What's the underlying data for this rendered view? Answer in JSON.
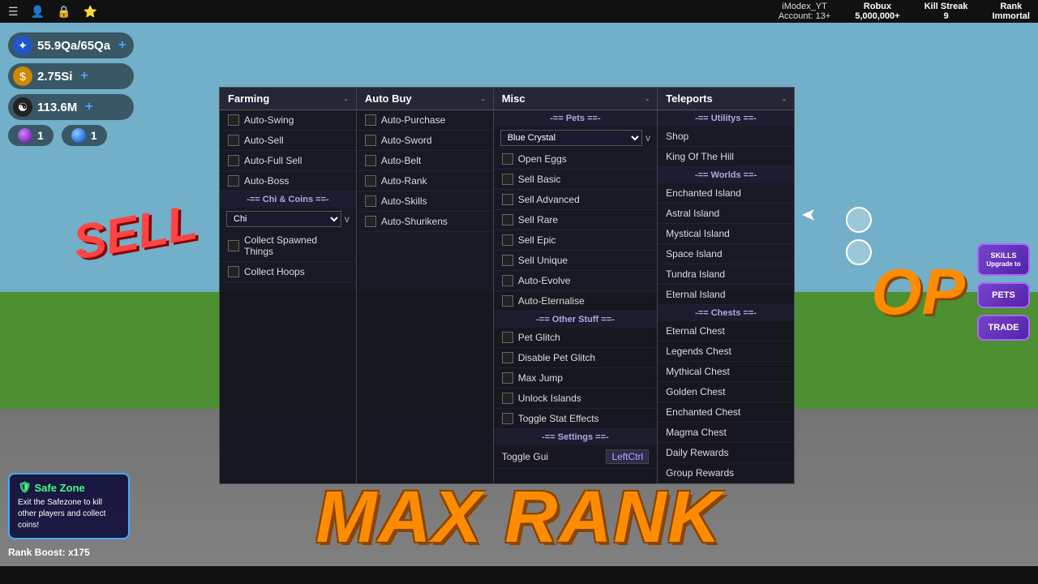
{
  "topBar": {
    "icons": [
      "☰",
      "👤",
      "🔒",
      "⭐"
    ],
    "user": {
      "name": "iModex_YT",
      "account": "Account: 13+"
    },
    "stats": [
      {
        "label": "Robux",
        "value": "5,000,000+"
      },
      {
        "label": "Kill Streak",
        "value": "9"
      },
      {
        "label": "Rank",
        "value": "Immortal"
      }
    ]
  },
  "hud": {
    "energy": {
      "value": "55.9Qa/65Qa",
      "icon": "✦"
    },
    "coins": {
      "value": "2.75Si",
      "icon": "$"
    },
    "chi": {
      "value": "113.6M",
      "icon": "☯"
    },
    "gems": [
      {
        "value": "1",
        "type": "purple"
      },
      {
        "value": "1",
        "type": "blue"
      }
    ]
  },
  "safeZone": {
    "title": "Safe Zone",
    "description": "Exit the Safezone to kill other players and collect coins!",
    "rankBoost": "Rank Boost: x175"
  },
  "rightButtons": [
    {
      "label": "SKILLS\nUpgrade to"
    },
    {
      "label": "PETS"
    },
    {
      "label": "TRADE"
    }
  ],
  "gameText": {
    "sell": "SELL",
    "maxRank": "MAX RANK",
    "op": "OP"
  },
  "menu": {
    "farming": {
      "header": "Farming",
      "dash": "-",
      "items": [
        {
          "label": "Auto-Swing",
          "hasCheckbox": true
        },
        {
          "label": "Auto-Sell",
          "hasCheckbox": true
        },
        {
          "label": "Auto-Full Sell",
          "hasCheckbox": true
        },
        {
          "label": "Auto-Boss",
          "hasCheckbox": true
        }
      ],
      "sections": [
        {
          "label": "-== Chi & Coins ==-",
          "items": [
            {
              "label": "Chi",
              "isSelect": true,
              "value": "Chi",
              "hasDropdown": true
            }
          ]
        },
        {
          "items": [
            {
              "label": "Collect Spawned Things",
              "hasCheckbox": true
            },
            {
              "label": "Collect Hoops",
              "hasCheckbox": true
            }
          ]
        }
      ]
    },
    "autoBuy": {
      "header": "Auto Buy",
      "dash": "-",
      "items": [
        {
          "label": "Auto-Purchase",
          "hasCheckbox": true
        },
        {
          "label": "Auto-Sword",
          "hasCheckbox": true
        },
        {
          "label": "Auto-Belt",
          "hasCheckbox": true
        },
        {
          "label": "Auto-Rank",
          "hasCheckbox": true
        },
        {
          "label": "Auto-Skills",
          "hasCheckbox": true
        },
        {
          "label": "Auto-Shurikens",
          "hasCheckbox": true
        }
      ]
    },
    "misc": {
      "header": "Misc",
      "dash": "-",
      "sections": [
        {
          "label": "-== Pets ==-",
          "items": [
            {
              "label": "Blue Crystal",
              "isSelect": true,
              "hasDropdown": true
            }
          ],
          "extraItems": [
            {
              "label": "Open Eggs",
              "hasCheckbox": true
            },
            {
              "label": "Sell Basic",
              "hasCheckbox": true
            },
            {
              "label": "Sell Advanced",
              "hasCheckbox": true
            },
            {
              "label": "Sell Rare",
              "hasCheckbox": true
            },
            {
              "label": "Sell Epic",
              "hasCheckbox": true
            },
            {
              "label": "Sell Unique",
              "hasCheckbox": true
            },
            {
              "label": "Auto-Evolve",
              "hasCheckbox": true
            },
            {
              "label": "Auto-Eternalise",
              "hasCheckbox": true
            }
          ]
        },
        {
          "label": "-== Other Stuff ==-",
          "items": [
            {
              "label": "Pet Glitch",
              "hasCheckbox": true
            },
            {
              "label": "Disable Pet Glitch",
              "hasCheckbox": true
            },
            {
              "label": "Max Jump",
              "hasCheckbox": true
            },
            {
              "label": "Unlock Islands",
              "hasCheckbox": true
            },
            {
              "label": "Toggle Stat Effects",
              "hasCheckbox": true
            }
          ]
        },
        {
          "label": "-== Settings ==-",
          "items": [
            {
              "label": "Toggle Gui",
              "isToggle": true,
              "toggleValue": "LeftCtrl"
            }
          ]
        }
      ]
    },
    "teleports": {
      "header": "Teleports",
      "dash": "-",
      "sections": [
        {
          "label": "-== Utilitys ==-",
          "items": [
            {
              "label": "Shop"
            },
            {
              "label": "King Of The Hill"
            }
          ]
        },
        {
          "label": "-== Worlds ==-",
          "items": [
            {
              "label": "Enchanted Island"
            },
            {
              "label": "Astral Island"
            },
            {
              "label": "Mystical Island"
            },
            {
              "label": "Space Island"
            },
            {
              "label": "Tundra Island"
            },
            {
              "label": "Eternal Island"
            }
          ]
        },
        {
          "label": "-== Chests ==-",
          "items": [
            {
              "label": "Eternal Chest"
            },
            {
              "label": "Legends Chest"
            },
            {
              "label": "Mythical Chest"
            },
            {
              "label": "Golden Chest"
            },
            {
              "label": "Enchanted Chest"
            },
            {
              "label": "Magma Chest"
            },
            {
              "label": "Daily Rewards"
            },
            {
              "label": "Group Rewards"
            }
          ]
        }
      ]
    }
  }
}
